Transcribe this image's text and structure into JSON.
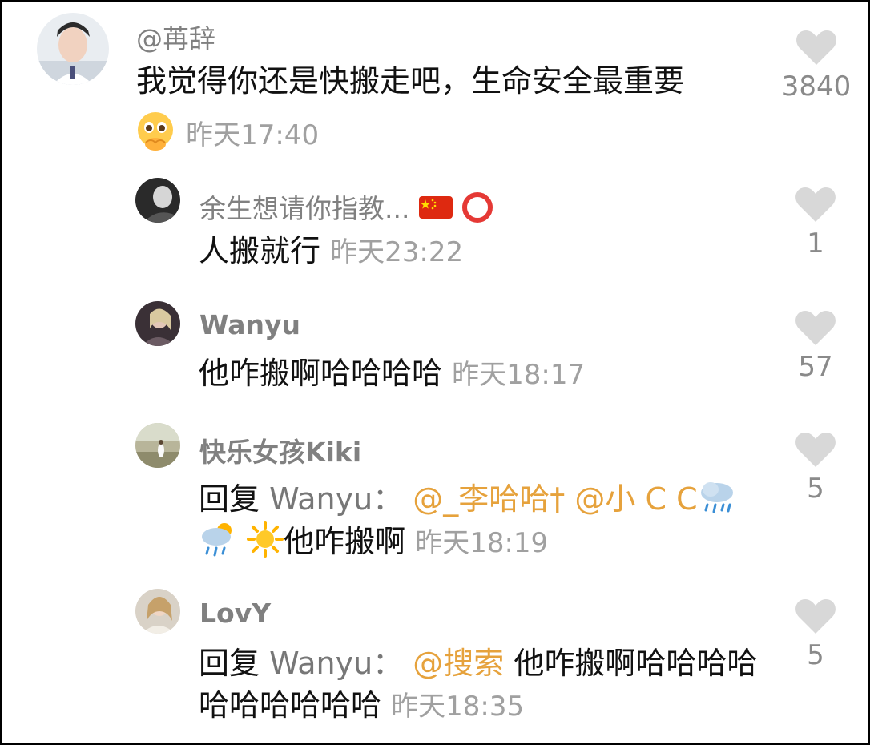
{
  "colors": {
    "username": "#808080",
    "timestamp": "#a0a0a0",
    "mention": "#e6a23c",
    "heart": "#d8d8d8"
  },
  "comments": [
    {
      "username": "@苒辞",
      "text": "我觉得你还是快搬走吧，生命安全最重要",
      "emoji": "pleading-hands-emoji",
      "time": "昨天17:40",
      "likes": "3840"
    },
    {
      "username": "余生想请你指教...",
      "username_icons": [
        "china-flag-emoji",
        "red-circle-emoji"
      ],
      "text": "人搬就行",
      "time": "昨天23:22",
      "likes": "1"
    },
    {
      "username": "Wanyu",
      "text": "他咋搬啊哈哈哈哈",
      "time": "昨天18:17",
      "likes": "57"
    },
    {
      "username": "快乐女孩Kiki",
      "reply_prefix": "回复 ",
      "reply_to": "Wanyu：",
      "mentions": [
        "@_李哈哈†",
        "@小 C C"
      ],
      "icons": [
        "rain-cloud-icon",
        "rain-cloud-sun-icon",
        "sun-icon"
      ],
      "text": "他咋搬啊",
      "time": "昨天18:19",
      "likes": "5"
    },
    {
      "username": "LovY",
      "reply_prefix": "回复 ",
      "reply_to": "Wanyu：",
      "mentions": [
        "@搜索"
      ],
      "text": "他咋搬啊哈哈哈哈",
      "text2": "哈哈哈哈哈哈",
      "time": "昨天18:35",
      "likes": "5"
    }
  ]
}
